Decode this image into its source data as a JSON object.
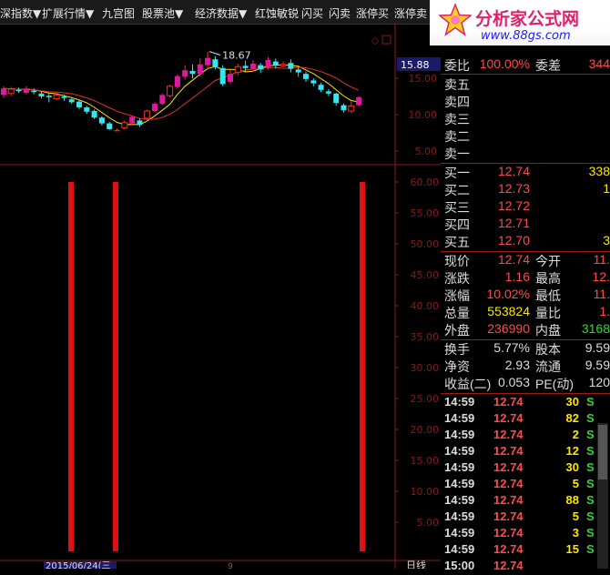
{
  "toolbar": {
    "items": [
      "深指数▼",
      "扩展行情▼",
      "九宫图",
      "股票池▼",
      "经济数据▼",
      "红蚀敏锐",
      "闪买",
      "闪卖",
      "涨停买",
      "涨停卖"
    ]
  },
  "logo": {
    "name": "分析家公式网",
    "url": "www.88gs.com"
  },
  "main_chart": {
    "price_tag": "15.88",
    "high_label": "18.67",
    "y_ticks": [
      "15.00",
      "10.00",
      "5.00"
    ],
    "candles": [
      {
        "o": 12.7,
        "c": 13.6,
        "h": 13.9,
        "l": 12.3
      },
      {
        "o": 12.9,
        "c": 13.5,
        "h": 13.8,
        "l": 12.6
      },
      {
        "o": 13.4,
        "c": 13.3,
        "h": 13.7,
        "l": 13.0
      },
      {
        "o": 13.0,
        "c": 13.6,
        "h": 13.9,
        "l": 12.8
      },
      {
        "o": 13.3,
        "c": 13.1,
        "h": 13.6,
        "l": 12.8
      },
      {
        "o": 12.9,
        "c": 12.5,
        "h": 13.2,
        "l": 12.2
      },
      {
        "o": 12.6,
        "c": 12.4,
        "h": 12.9,
        "l": 11.7
      },
      {
        "o": 12.2,
        "c": 12.7,
        "h": 13.1,
        "l": 12.0
      },
      {
        "o": 12.5,
        "c": 12.3,
        "h": 12.8,
        "l": 11.9
      },
      {
        "o": 12.1,
        "c": 11.7,
        "h": 12.3,
        "l": 11.5
      },
      {
        "o": 11.8,
        "c": 11.0,
        "h": 12.0,
        "l": 10.7
      },
      {
        "o": 11.0,
        "c": 10.4,
        "h": 11.2,
        "l": 10.1
      },
      {
        "o": 10.5,
        "c": 9.6,
        "h": 10.7,
        "l": 9.4
      },
      {
        "o": 9.6,
        "c": 8.8,
        "h": 9.8,
        "l": 8.5
      },
      {
        "o": 8.8,
        "c": 8.0,
        "h": 9.0,
        "l": 7.9
      },
      {
        "o": 7.9,
        "c": 7.9,
        "h": 8.1,
        "l": 7.8
      },
      {
        "o": 8.2,
        "c": 8.9,
        "h": 9.2,
        "l": 8.0
      },
      {
        "o": 8.8,
        "c": 9.7,
        "h": 9.9,
        "l": 8.6
      },
      {
        "o": 9.2,
        "c": 8.6,
        "h": 9.5,
        "l": 8.3
      },
      {
        "o": 9.5,
        "c": 10.5,
        "h": 10.7,
        "l": 9.3
      },
      {
        "o": 10.5,
        "c": 11.5,
        "h": 11.7,
        "l": 10.3
      },
      {
        "o": 11.5,
        "c": 12.7,
        "h": 12.9,
        "l": 11.3
      },
      {
        "o": 12.6,
        "c": 13.9,
        "h": 14.1,
        "l": 12.4
      },
      {
        "o": 13.8,
        "c": 15.3,
        "h": 15.5,
        "l": 13.6
      },
      {
        "o": 15.2,
        "c": 16.1,
        "h": 16.8,
        "l": 14.8
      },
      {
        "o": 16.0,
        "c": 15.6,
        "h": 16.9,
        "l": 15.0
      },
      {
        "o": 15.6,
        "c": 16.9,
        "h": 17.7,
        "l": 15.2
      },
      {
        "o": 16.8,
        "c": 17.8,
        "h": 18.67,
        "l": 16.3
      },
      {
        "o": 17.6,
        "c": 16.6,
        "h": 18.0,
        "l": 16.2
      },
      {
        "o": 16.4,
        "c": 14.2,
        "h": 16.8,
        "l": 13.9
      },
      {
        "o": 14.5,
        "c": 15.6,
        "h": 16.2,
        "l": 14.2
      },
      {
        "o": 15.8,
        "c": 16.6,
        "h": 17.0,
        "l": 15.4
      },
      {
        "o": 16.7,
        "c": 16.4,
        "h": 17.4,
        "l": 15.8
      },
      {
        "o": 16.3,
        "c": 17.0,
        "h": 17.5,
        "l": 15.9
      },
      {
        "o": 16.8,
        "c": 16.2,
        "h": 17.1,
        "l": 15.7
      },
      {
        "o": 16.5,
        "c": 17.5,
        "h": 17.9,
        "l": 16.2
      },
      {
        "o": 17.3,
        "c": 16.8,
        "h": 17.7,
        "l": 16.3
      },
      {
        "o": 16.9,
        "c": 16.9,
        "h": 17.3,
        "l": 16.5
      },
      {
        "o": 17.1,
        "c": 16.3,
        "h": 17.6,
        "l": 15.8
      },
      {
        "o": 16.2,
        "c": 15.8,
        "h": 16.6,
        "l": 15.2
      },
      {
        "o": 15.6,
        "c": 14.9,
        "h": 15.9,
        "l": 14.5
      },
      {
        "o": 14.7,
        "c": 14.3,
        "h": 15.0,
        "l": 13.9
      },
      {
        "o": 14.1,
        "c": 13.4,
        "h": 14.4,
        "l": 13.1
      },
      {
        "o": 13.2,
        "c": 12.9,
        "h": 13.5,
        "l": 12.6
      },
      {
        "o": 12.9,
        "c": 11.6,
        "h": 13.0,
        "l": 11.2
      },
      {
        "o": 11.3,
        "c": 10.6,
        "h": 11.5,
        "l": 10.3
      },
      {
        "o": 10.5,
        "c": 11.2,
        "h": 11.8,
        "l": 10.2
      },
      {
        "o": 11.3,
        "c": 12.4,
        "h": 12.5,
        "l": 11.1
      }
    ]
  },
  "sub_chart": {
    "y_ticks": [
      "60.00",
      "55.00",
      "50.00",
      "45.00",
      "40.00",
      "35.00",
      "30.00",
      "25.00",
      "20.00",
      "15.00",
      "10.00",
      "5.00"
    ],
    "date_label": "2015/06/24(三",
    "period_label": "日线"
  },
  "panel": {
    "weibi": {
      "label": "委比",
      "value": "100.00%",
      "label2": "委差",
      "value2": "344"
    },
    "sell": [
      {
        "label": "卖五",
        "price": "",
        "vol": ""
      },
      {
        "label": "卖四",
        "price": "",
        "vol": ""
      },
      {
        "label": "卖三",
        "price": "",
        "vol": ""
      },
      {
        "label": "卖二",
        "price": "",
        "vol": ""
      },
      {
        "label": "卖一",
        "price": "",
        "vol": ""
      }
    ],
    "buy": [
      {
        "label": "买一",
        "price": "12.74",
        "vol": "338"
      },
      {
        "label": "买二",
        "price": "12.73",
        "vol": "1"
      },
      {
        "label": "买三",
        "price": "12.72",
        "vol": ""
      },
      {
        "label": "买四",
        "price": "12.71",
        "vol": ""
      },
      {
        "label": "买五",
        "price": "12.70",
        "vol": "3"
      }
    ],
    "quote": [
      {
        "l1": "现价",
        "v1": "12.74",
        "c1": "red",
        "l2": "今开",
        "v2": "11.",
        "c2": "red"
      },
      {
        "l1": "涨跌",
        "v1": "1.16",
        "c1": "red",
        "l2": "最高",
        "v2": "12.",
        "c2": "red"
      },
      {
        "l1": "涨幅",
        "v1": "10.02%",
        "c1": "red",
        "l2": "最低",
        "v2": "11.",
        "c2": "red"
      },
      {
        "l1": "总量",
        "v1": "553824",
        "c1": "yel",
        "l2": "量比",
        "v2": "1.",
        "c2": "red"
      },
      {
        "l1": "外盘",
        "v1": "236990",
        "c1": "red",
        "l2": "内盘",
        "v2": "3168",
        "c2": "grn"
      }
    ],
    "stats": [
      {
        "l1": "换手",
        "v1": "5.77%",
        "l2": "股本",
        "v2": "9.59"
      },
      {
        "l1": "净资",
        "v1": "2.93",
        "l2": "流通",
        "v2": "9.59"
      },
      {
        "l1": "收益(二)",
        "v1": "0.053",
        "l2": "PE(动)",
        "v2": "120"
      }
    ],
    "ticks": [
      {
        "time": "14:59",
        "price": "12.74",
        "vol": "30",
        "side": "S"
      },
      {
        "time": "14:59",
        "price": "12.74",
        "vol": "82",
        "side": "S"
      },
      {
        "time": "14:59",
        "price": "12.74",
        "vol": "2",
        "side": "S"
      },
      {
        "time": "14:59",
        "price": "12.74",
        "vol": "12",
        "side": "S"
      },
      {
        "time": "14:59",
        "price": "12.74",
        "vol": "30",
        "side": "S"
      },
      {
        "time": "14:59",
        "price": "12.74",
        "vol": "5",
        "side": "S"
      },
      {
        "time": "14:59",
        "price": "12.74",
        "vol": "88",
        "side": "S"
      },
      {
        "time": "14:59",
        "price": "12.74",
        "vol": "5",
        "side": "S"
      },
      {
        "time": "14:59",
        "price": "12.74",
        "vol": "3",
        "side": "S"
      },
      {
        "time": "14:59",
        "price": "12.74",
        "vol": "15",
        "side": "S"
      },
      {
        "time": "15:00",
        "price": "12.74",
        "vol": "",
        "side": ""
      }
    ]
  },
  "colors": {
    "up": "#ff2a2a",
    "up_fill": "#e0189f",
    "down": "#33e6f0",
    "ma_yellow": "#ffe600",
    "ma_red": "#e03030",
    "grid": "#8a1a1a",
    "bar": "#e01010"
  }
}
